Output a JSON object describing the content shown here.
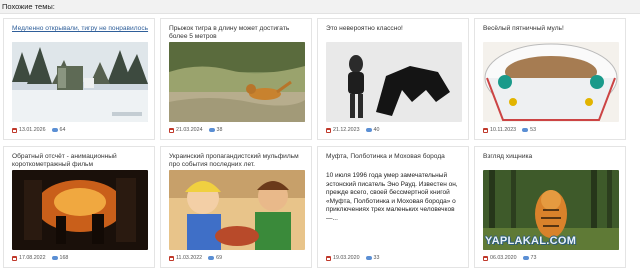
{
  "section": {
    "title": "Похожие темы:"
  },
  "cards": [
    {
      "title": "Медленно открывали, тигру не понравилось",
      "date": "13.01.2026",
      "comments": "64",
      "image": "snow-truck-video"
    },
    {
      "title": "Прыжок тигра в длину может достигать более 5 метров",
      "date": "21.03.2024",
      "comments": "38",
      "image": "tiger-jumping-river"
    },
    {
      "title": "Это невероятно классно!",
      "date": "21.12.2023",
      "comments": "40",
      "image": "woman-with-dog"
    },
    {
      "title": "Весёлый пятничный муль!",
      "date": "10.11.2023",
      "comments": "53",
      "image": "cartoon-bowl"
    },
    {
      "title": "Обратный отсчёт - анимационный короткометражный фильм",
      "date": "17.08.2022",
      "comments": "168",
      "image": "fire-scene"
    },
    {
      "title": "Украинский пропагандистский мульфильм про события последних лет.",
      "date": "11.03.2022",
      "comments": "69",
      "image": "cartoon-children"
    },
    {
      "title": "Муфта, Полботинка и Моховая борода",
      "date": "19.03.2020",
      "comments": "33",
      "excerpt": "10 июля 1996 года умер замечательный эстонский писатель Эно Рауд. Известен он, прежде всего, своей бессмертной книгой «Муфта, Полботинка и Моховая борода» о приключениях трех маленьких человечков —..."
    },
    {
      "title": "Взгляд хищника",
      "date": "06.03.2020",
      "comments": "73",
      "image": "tiger-in-forest",
      "watermark": "YAPLAKAL.COM"
    }
  ],
  "colors": {
    "link": "#2f5f9a",
    "calendar": "#c0392b",
    "comment": "#5b8fd4"
  }
}
